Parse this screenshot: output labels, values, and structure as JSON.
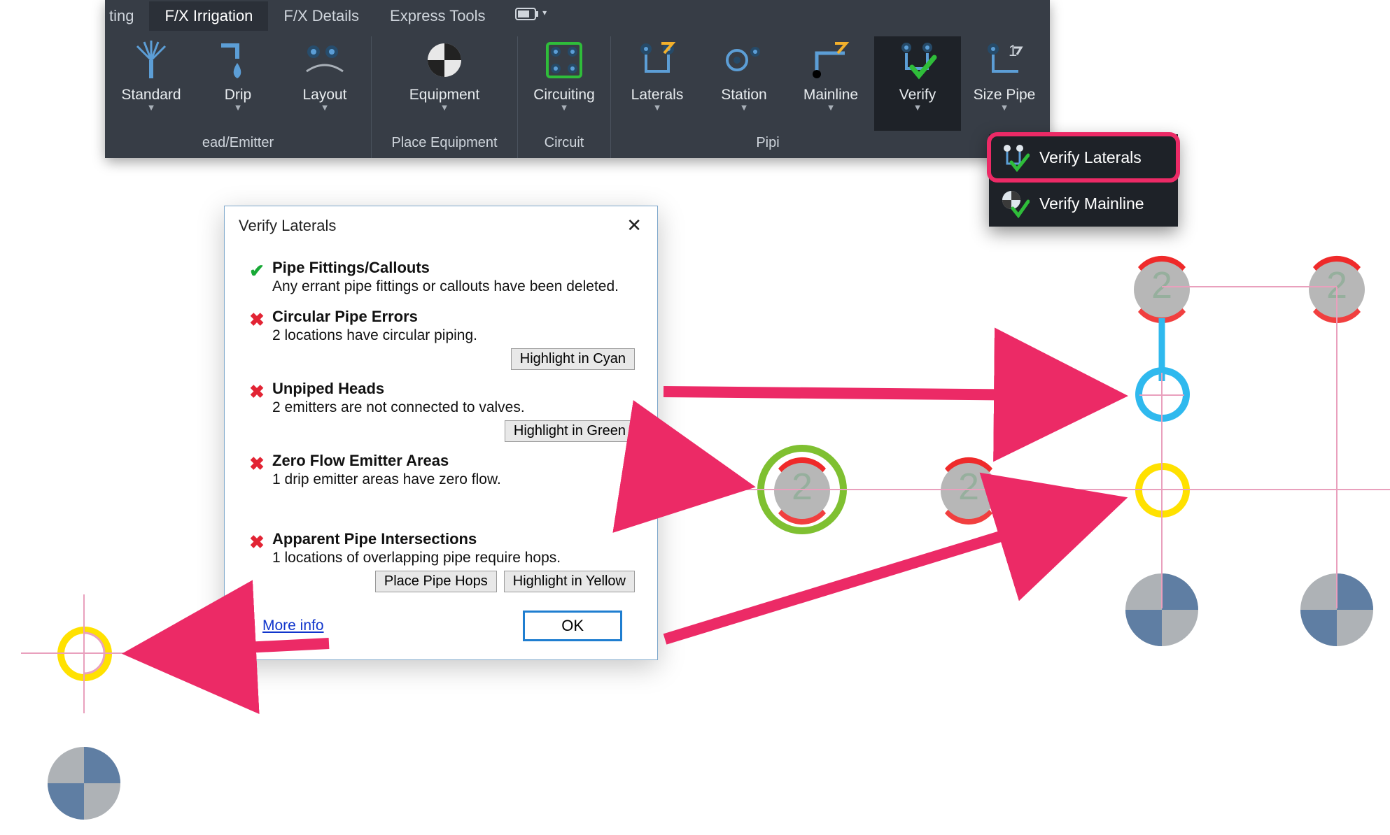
{
  "ribbon": {
    "tabs": {
      "partial_left": "ting",
      "active": "F/X Irrigation",
      "details": "F/X Details",
      "express": "Express Tools"
    },
    "buttons": {
      "standard": "Standard",
      "drip": "Drip",
      "layout": "Layout",
      "equipment": "Equipment",
      "circuiting": "Circuiting",
      "laterals": "Laterals",
      "station": "Station",
      "mainline": "Mainline",
      "verify": "Verify",
      "sizepipe": "Size Pipe"
    },
    "panels": {
      "head_emitter": "ead/Emitter",
      "place_equipment": "Place Equipment",
      "circuit": "Circuit",
      "piping": "Pipi"
    }
  },
  "flyout": {
    "verify_laterals": "Verify Laterals",
    "verify_mainline": "Verify Mainline"
  },
  "dialog": {
    "title": "Verify Laterals",
    "sections": {
      "fittings": {
        "heading": "Pipe Fittings/Callouts",
        "text": "Any errant pipe fittings or callouts have been deleted."
      },
      "circular": {
        "heading": "Circular Pipe Errors",
        "text": "2 locations have circular piping.",
        "button": "Highlight in Cyan"
      },
      "unpiped": {
        "heading": "Unpiped Heads",
        "text": "2 emitters are not connected to valves.",
        "button": "Highlight in Green"
      },
      "zeroflow": {
        "heading": "Zero Flow Emitter Areas",
        "text": "1 drip emitter areas have zero flow."
      },
      "intersections": {
        "heading": "Apparent Pipe Intersections",
        "text": "1 locations of overlapping pipe require hops.",
        "button_hops": "Place Pipe Hops",
        "button_highlight": "Highlight in Yellow"
      }
    },
    "more_info": "More info",
    "ok": "OK"
  },
  "heads": {
    "label": "2"
  }
}
